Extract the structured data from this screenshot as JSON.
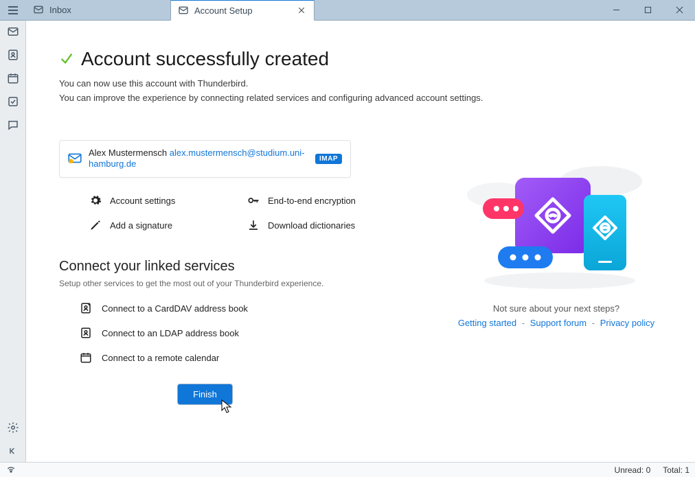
{
  "tabs": {
    "inbox": "Inbox",
    "account_setup": "Account Setup"
  },
  "headline": "Account successfully created",
  "intro_line1": "You can now use this account with Thunderbird.",
  "intro_line2": "You can improve the experience by connecting related services and configuring advanced account settings.",
  "account": {
    "name": "Alex Mustermensch",
    "email": "alex.mustermensch@studium.uni-hamburg.de",
    "protocol": "IMAP"
  },
  "settings": {
    "account_settings": "Account settings",
    "e2e": "End-to-end encryption",
    "signature": "Add a signature",
    "dictionaries": "Download dictionaries"
  },
  "linked": {
    "title": "Connect your linked services",
    "subtitle": "Setup other services to get the most out of your Thunderbird experience.",
    "carddav": "Connect to a CardDAV address book",
    "ldap": "Connect to an LDAP address book",
    "calendar": "Connect to a remote calendar"
  },
  "finish": "Finish",
  "help": {
    "question": "Not sure about your next steps?",
    "getting_started": "Getting started",
    "support": "Support forum",
    "privacy": "Privacy policy"
  },
  "status": {
    "unread_label": "Unread:",
    "unread_value": "0",
    "total_label": "Total:",
    "total_value": "1"
  }
}
